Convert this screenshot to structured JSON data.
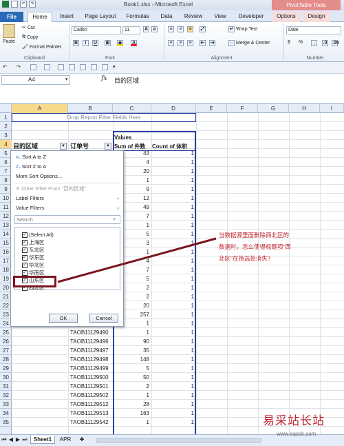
{
  "window": {
    "title": "Book1.xlsx - Microsoft Excel",
    "context_tab": "PivotTable Tools"
  },
  "tabs": [
    "File",
    "Home",
    "Insert",
    "Page Layout",
    "Formulas",
    "Data",
    "Review",
    "View",
    "Developer",
    "Options",
    "Design"
  ],
  "ribbon": {
    "clipboard": {
      "paste": "Paste",
      "cut": "Cut",
      "copy": "Copy",
      "format_painter": "Format Painter",
      "label": "Clipboard"
    },
    "font": {
      "name": "Calibri",
      "size": "11",
      "label": "Font"
    },
    "alignment": {
      "wrap": "Wrap Text",
      "merge": "Merge & Center",
      "label": "Alignment"
    },
    "number": {
      "format": "Date",
      "label": "Number",
      "currency": "$",
      "percent": "%"
    }
  },
  "formula_bar": {
    "name_box": "A4",
    "fx": "fx",
    "value": "目的区域"
  },
  "columns": [
    "A",
    "B",
    "C",
    "D",
    "E",
    "F",
    "G",
    "H",
    "I"
  ],
  "rows": [
    "1",
    "2",
    "3",
    "4",
    "5",
    "6",
    "7",
    "8",
    "9",
    "10",
    "11",
    "12",
    "13",
    "14",
    "15",
    "16",
    "17",
    "18",
    "19",
    "20",
    "21",
    "22",
    "23",
    "24",
    "25",
    "26",
    "27",
    "28",
    "29",
    "30",
    "31",
    "32",
    "33",
    "34",
    "35"
  ],
  "pivot": {
    "filter_drop": "Drop Report Filter Fields Here",
    "values_label": "Values",
    "row_header_a": "目的区域",
    "row_header_b": "订单号",
    "col_sum": "Sum of 件数",
    "col_count": "Count of 体积",
    "sum_values": [
      "43",
      "4",
      "20",
      "1",
      "9",
      "12",
      "49",
      "7",
      "1",
      "5",
      "3",
      "1",
      "4",
      "7",
      "5",
      "2",
      "2",
      "20",
      "257",
      "1",
      "1",
      "90",
      "35",
      "148",
      "5",
      "50",
      "2",
      "1",
      "28",
      "163",
      "1"
    ],
    "count_values": [
      "1",
      "1",
      "1",
      "1",
      "1",
      "1",
      "1",
      "1",
      "1",
      "1",
      "1",
      "1",
      "1",
      "1",
      "1",
      "1",
      "1",
      "1",
      "1",
      "1",
      "1",
      "1",
      "1",
      "1",
      "1",
      "1",
      "1",
      "1",
      "1",
      "1",
      "1"
    ],
    "order_ids": [
      "TAOB11129489",
      "TAOB11129490",
      "TAOB11129496",
      "TAOB11129497",
      "TAOB11129498",
      "TAOB11129499",
      "TAOB11129500",
      "TAOB11129501",
      "TAOB11129502",
      "TAOB11129512",
      "TAOB11129513",
      "TAOB11129542"
    ]
  },
  "filter_menu": {
    "sort_az": "Sort A to Z",
    "sort_za": "Sort Z to A",
    "more_sort": "More Sort Options...",
    "clear_filter": "Clear Filter From \"目的区域\"",
    "label_filters": "Label Filters",
    "value_filters": "Value Filters",
    "search_placeholder": "Search",
    "items": [
      "(Select All)",
      "上海区",
      "东北区",
      "华东区",
      "华北区",
      "华南区",
      "山东区",
      "西北区"
    ],
    "ok": "OK",
    "cancel": "Cancel"
  },
  "annotation": "当数据源里面删除西北区的数据时，怎么使得标题项“西北区”在筛选处消失？",
  "sheets": [
    "Sheet1",
    "APR"
  ],
  "watermark": {
    "text": "易采站长站",
    "url": "www.easck.com"
  },
  "colors": {
    "annotation": "#c0262e",
    "file_tab": "#2a6bb8",
    "pivot_tools": "#e48b8b",
    "selection": "#f9d98b",
    "pivot_border": "#2b3f9e"
  }
}
